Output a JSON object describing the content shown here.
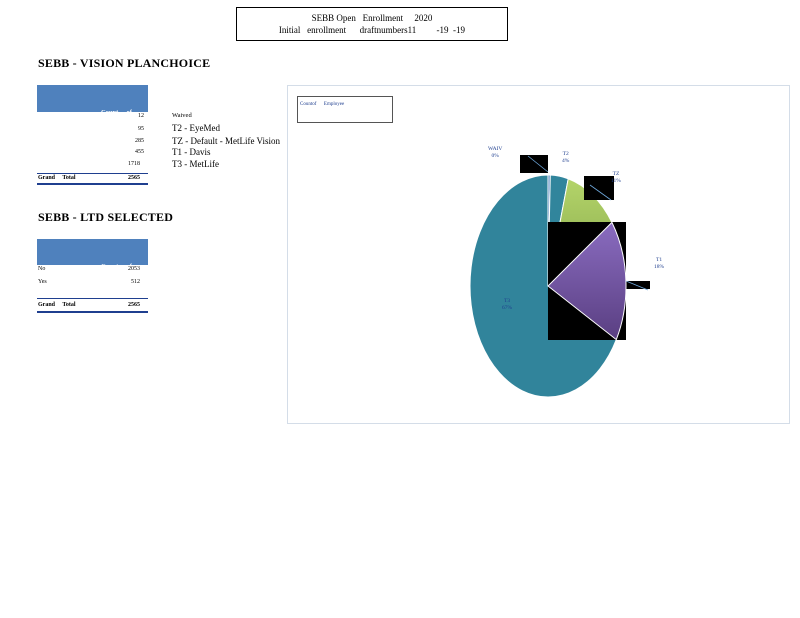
{
  "header": {
    "line1": "SEBB Open   Enrollment     2020",
    "line2": "Initial   enrollment      draftnumbers11         -19  -19"
  },
  "vision": {
    "title": "SEBB - VISION PLANCHOICE",
    "col_header": [
      "Count     of",
      "Employee"
    ],
    "rows": [
      {
        "value": "12",
        "label": "Waived"
      },
      {
        "value": "95",
        "label": "T2 - EyeMed"
      },
      {
        "value": "285",
        "label": "TZ - Default - MetLife Vision"
      },
      {
        "value": "455",
        "label": "T1 - Davis"
      },
      {
        "value": "1718",
        "label": "T3 - MetLife"
      }
    ],
    "total_label": "Grand     Total",
    "total_value": "2565"
  },
  "ltd": {
    "title": "SEBB - LTD SELECTED",
    "col_header": [
      "Count     of",
      "Employee"
    ],
    "rows": [
      {
        "label": "No",
        "value": "2053"
      },
      {
        "label": "Yes",
        "value": "512"
      }
    ],
    "total_label": "Grand     Total",
    "total_value": "2565"
  },
  "chart_data": {
    "type": "pie",
    "legend_title": "Countof      Employee",
    "slices": [
      {
        "label": "WAIV",
        "percent_label": "0%",
        "value": 12,
        "color": "#4f81bd"
      },
      {
        "label": "T2",
        "percent_label": "4%",
        "value": 95,
        "color": "#31859c"
      },
      {
        "label": "TZ",
        "percent_label": "11%",
        "value": 285,
        "color": "#9bbb59"
      },
      {
        "label": "T1",
        "percent_label": "18%",
        "value": 455,
        "color": "#8064a2"
      },
      {
        "label": "T3",
        "percent_label": "67%",
        "value": 1718,
        "color": "#31859c"
      }
    ]
  }
}
